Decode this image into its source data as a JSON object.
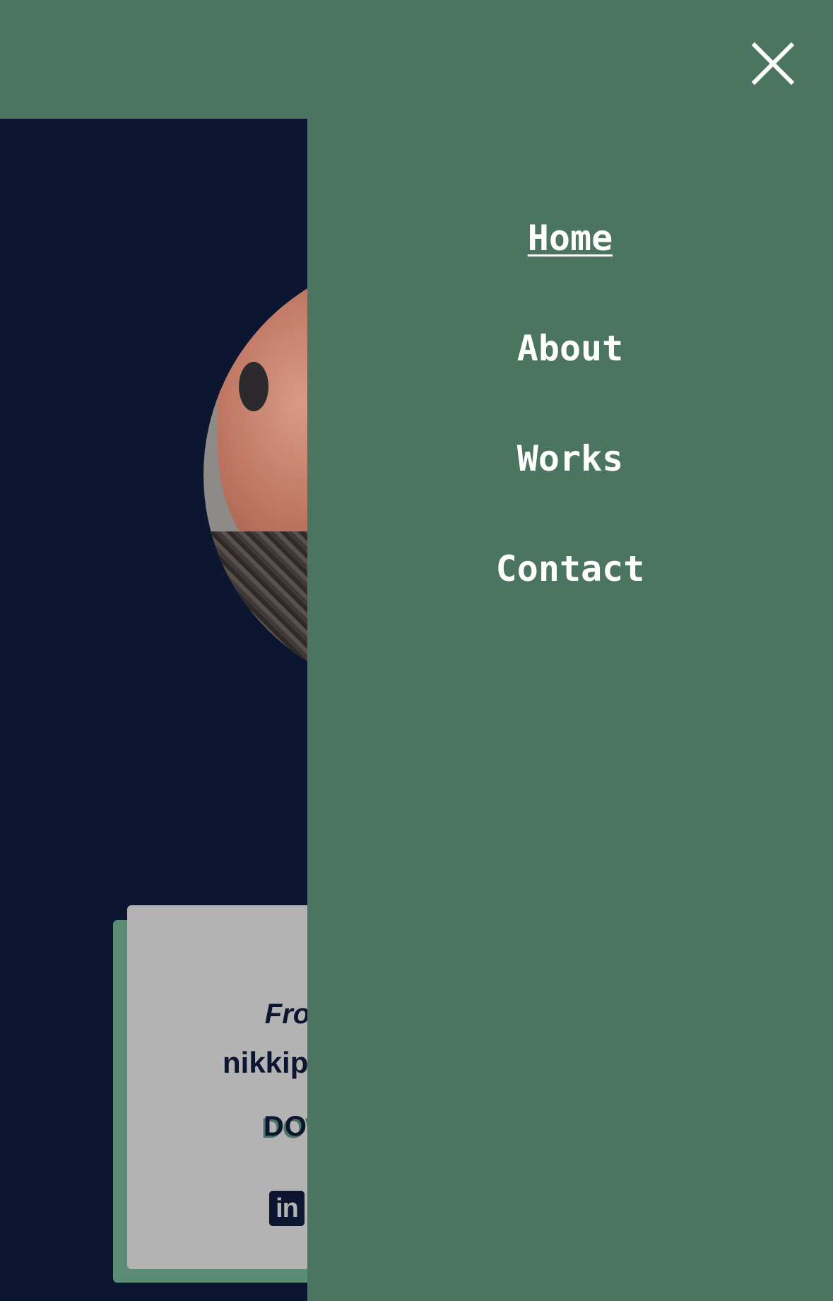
{
  "colors": {
    "menu_bg": "#4b7560",
    "hero_bg": "#0d1631",
    "card_bg": "#b3b3b3",
    "card_shadow": "#5a8c75",
    "text_light": "#ffffff",
    "text_dark": "#0d1631"
  },
  "menu": {
    "close_icon": "close-icon",
    "items": [
      {
        "label": "Home",
        "active": true
      },
      {
        "label": "About",
        "active": false
      },
      {
        "label": "Works",
        "active": false
      },
      {
        "label": "Contact",
        "active": false
      }
    ]
  },
  "card": {
    "tagline_partial": "Fro",
    "email_partial": "nikkip",
    "download_partial": "DOW",
    "linkedin_icon": "linkedin-icon",
    "linkedin_glyph": "in"
  }
}
